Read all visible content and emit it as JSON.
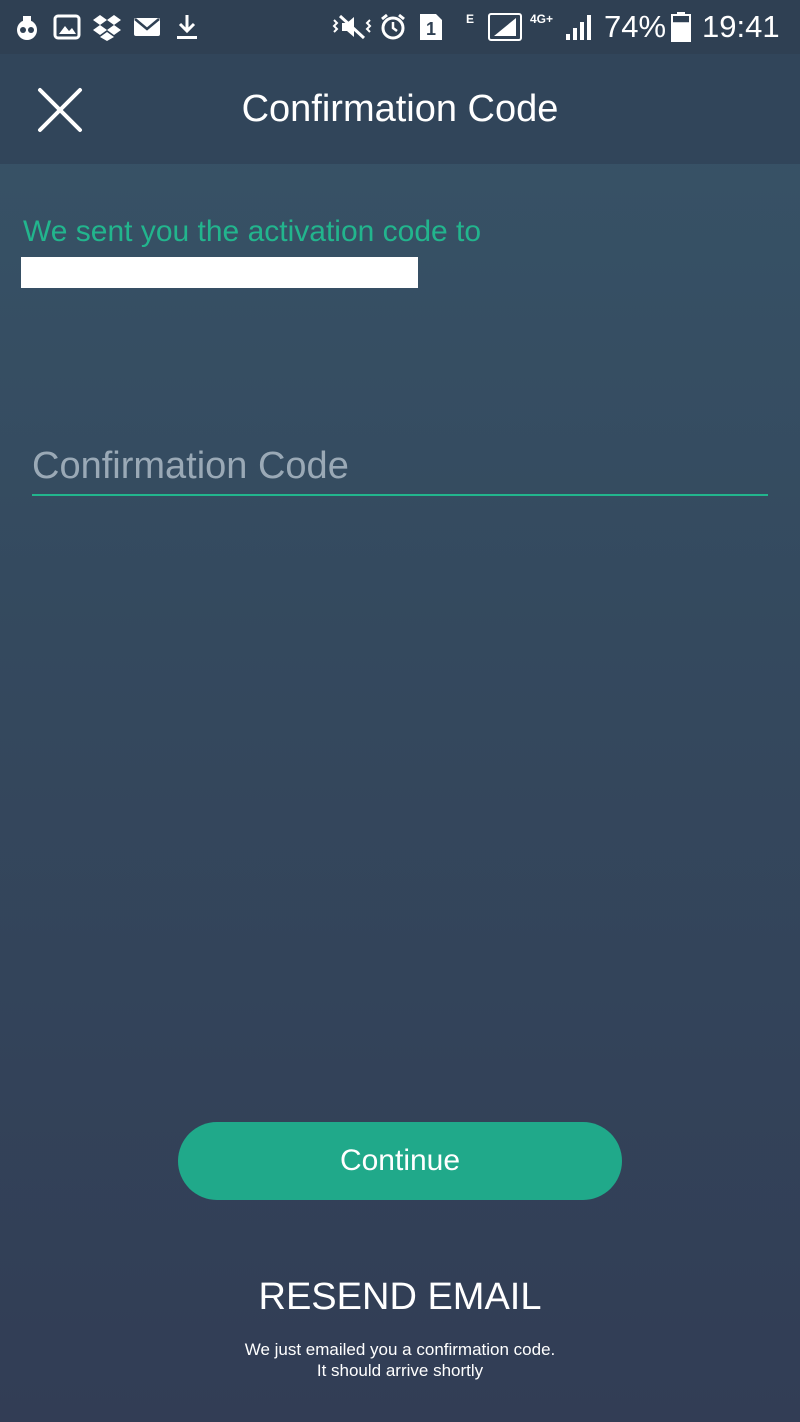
{
  "status_bar": {
    "network_label": "4G+",
    "network_type_label": "E",
    "sim_slot_label": "1",
    "battery_percent": "74%",
    "battery_level": 0.74,
    "time": "19:41"
  },
  "app_bar": {
    "title": "Confirmation Code"
  },
  "content": {
    "sent_message": "We sent you the activation code to",
    "code_input": {
      "placeholder": "Confirmation Code",
      "value": ""
    }
  },
  "actions": {
    "continue_label": "Continue",
    "resend_label": "RESEND EMAIL",
    "resend_note_line1": "We just emailed you a confirmation code.",
    "resend_note_line2": "It should arrive shortly"
  },
  "colors": {
    "accent": "#22b58d",
    "button": "#20a98a",
    "app_bar": "#31455a",
    "status_bar": "#2f4053"
  },
  "icons": {
    "status_left": [
      "incognito-icon",
      "gallery-icon",
      "dropbox-icon",
      "mail-icon",
      "download-icon"
    ],
    "status_right": [
      "mute-vibrate-icon",
      "alarm-icon",
      "sim-icon",
      "signal-icon",
      "signal-icon",
      "battery-icon"
    ],
    "app_bar": "close-icon"
  }
}
